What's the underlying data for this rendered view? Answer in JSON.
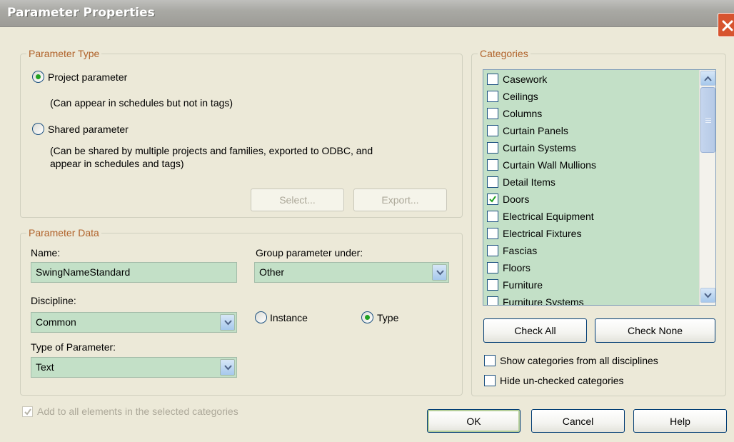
{
  "window": {
    "title": "Parameter Properties"
  },
  "parameter_type": {
    "legend": "Parameter Type",
    "project_label": "Project parameter",
    "project_desc": "(Can appear in schedules but not in tags)",
    "shared_label": "Shared parameter",
    "shared_desc_line1": "(Can be shared by multiple projects and families, exported to ODBC, and",
    "shared_desc_line2": "appear in schedules and tags)",
    "select_button": "Select...",
    "export_button": "Export...",
    "selected": "project"
  },
  "parameter_data": {
    "legend": "Parameter Data",
    "name_label": "Name:",
    "name_value": "SwingNameStandard",
    "group_label": "Group parameter under:",
    "group_value": "Other",
    "discipline_label": "Discipline:",
    "discipline_value": "Common",
    "instance_label": "Instance",
    "type_label": "Type",
    "binding_selected": "type",
    "type_param_label": "Type of Parameter:",
    "type_param_value": "Text"
  },
  "categories": {
    "legend": "Categories",
    "items": [
      {
        "label": "Casework",
        "checked": false
      },
      {
        "label": "Ceilings",
        "checked": false
      },
      {
        "label": "Columns",
        "checked": false
      },
      {
        "label": "Curtain Panels",
        "checked": false
      },
      {
        "label": "Curtain Systems",
        "checked": false
      },
      {
        "label": "Curtain Wall Mullions",
        "checked": false
      },
      {
        "label": "Detail Items",
        "checked": false
      },
      {
        "label": "Doors",
        "checked": true
      },
      {
        "label": "Electrical Equipment",
        "checked": false
      },
      {
        "label": "Electrical Fixtures",
        "checked": false
      },
      {
        "label": "Fascias",
        "checked": false
      },
      {
        "label": "Floors",
        "checked": false
      },
      {
        "label": "Furniture",
        "checked": false
      },
      {
        "label": "Furniture Systems",
        "checked": false
      }
    ],
    "check_all_button": "Check All",
    "check_none_button": "Check None",
    "show_all_label": "Show categories from all disciplines",
    "hide_unchecked_label": "Hide un-checked categories"
  },
  "footer": {
    "add_all_label": "Add to all elements in the selected categories",
    "add_all_checked": true,
    "ok_button": "OK",
    "cancel_button": "Cancel",
    "help_button": "Help"
  },
  "colors": {
    "field_bg": "#c3e0c7",
    "legend_text": "#b0622a",
    "dialog_bg": "#ece9d8"
  }
}
